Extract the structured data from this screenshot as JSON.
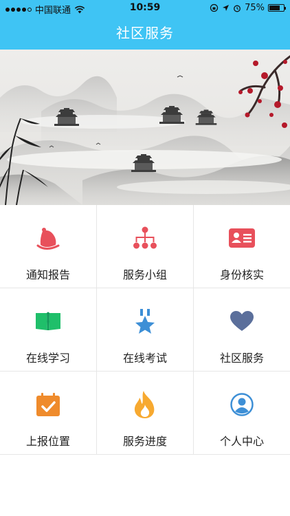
{
  "status_bar": {
    "carrier": "中国联通",
    "time": "10:59",
    "battery": "75%",
    "battery_level": 0.75
  },
  "nav": {
    "title": "社区服务"
  },
  "banner": {
    "page_count": 1,
    "active_page": 0
  },
  "grid": {
    "items": [
      {
        "label": "通知报告",
        "icon": "bell-icon",
        "color": "#e8505b"
      },
      {
        "label": "服务小组",
        "icon": "org-chart-icon",
        "color": "#e8505b"
      },
      {
        "label": "身份核实",
        "icon": "id-card-icon",
        "color": "#e8505b"
      },
      {
        "label": "在线学习",
        "icon": "book-icon",
        "color": "#1fbf6a"
      },
      {
        "label": "在线考试",
        "icon": "medal-icon",
        "color": "#3d8fd6"
      },
      {
        "label": "社区服务",
        "icon": "heart-icon",
        "color": "#5b6f9b"
      },
      {
        "label": "上报位置",
        "icon": "calendar-check-icon",
        "color": "#ef8b2c"
      },
      {
        "label": "服务进度",
        "icon": "flame-icon",
        "color": "#f7a930"
      },
      {
        "label": "个人中心",
        "icon": "user-circle-icon",
        "color": "#3d8fd6"
      }
    ]
  }
}
